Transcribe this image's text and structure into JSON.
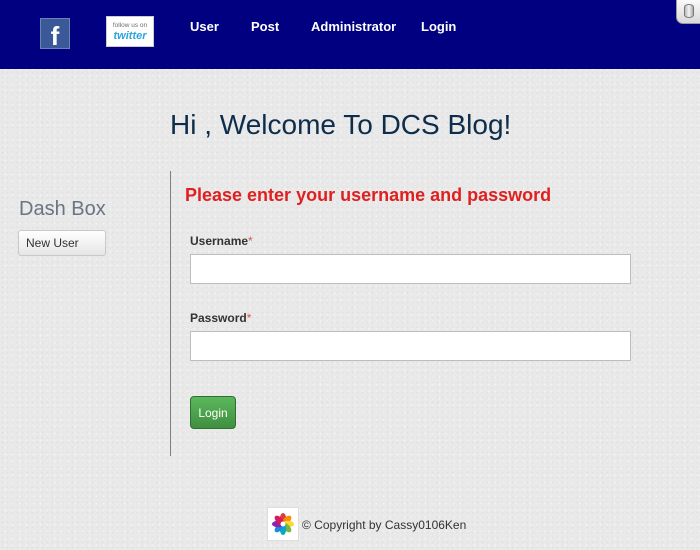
{
  "nav": {
    "facebook_glyph": "f",
    "twitter_small": "follow us on",
    "twitter_big": "twitter",
    "links": [
      {
        "label": "User"
      },
      {
        "label": "Post"
      },
      {
        "label": "Administrator"
      },
      {
        "label": "Login"
      }
    ]
  },
  "heading": "Hi , Welcome To DCS Blog!",
  "sidebar": {
    "title": "Dash Box",
    "new_user_label": "New User"
  },
  "form": {
    "heading": "Please enter your username and password",
    "username_label": "Username",
    "password_label": "Password",
    "required_marker": "*",
    "username_value": "",
    "password_value": "",
    "submit_label": "Login"
  },
  "footer": {
    "copyright": "© Copyright by Cassy0106Ken"
  },
  "colors": {
    "nav_bg": "#000080",
    "form_heading": "#e02020",
    "login_button": "#4cae4c"
  },
  "icons": [
    "facebook-icon",
    "twitter-follow-icon",
    "database-icon",
    "flower-logo-icon"
  ]
}
